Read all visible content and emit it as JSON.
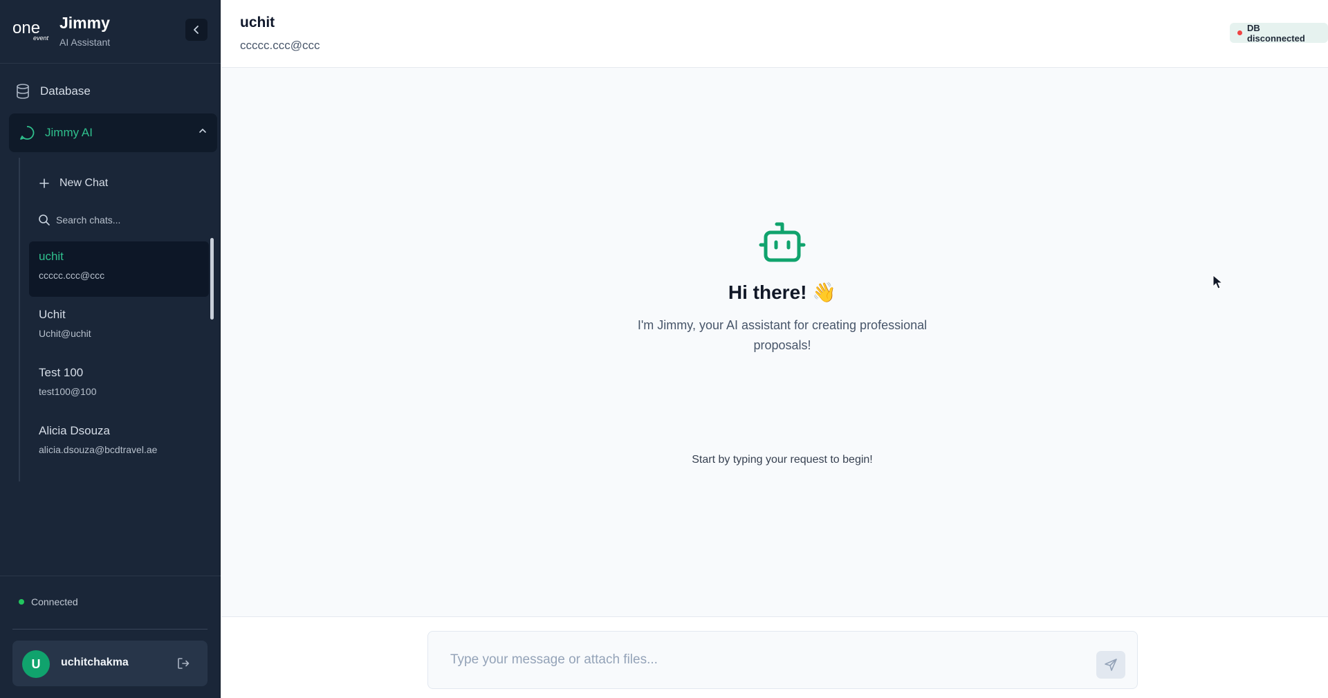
{
  "brand": {
    "logo_text": "one",
    "logo_subtext": "event",
    "name": "Jimmy",
    "subtitle": "AI Assistant"
  },
  "nav": {
    "database": "Database",
    "jimmy_ai": "Jimmy AI"
  },
  "chats": {
    "new_chat": "New Chat",
    "search_placeholder": "Search chats...",
    "items": [
      {
        "name": "uchit",
        "email": "ccccc.ccc@ccc"
      },
      {
        "name": "Uchit",
        "email": "Uchit@uchit"
      },
      {
        "name": "Test 100",
        "email": "test100@100"
      },
      {
        "name": "Alicia Dsouza",
        "email": "alicia.dsouza@bcdtravel.ae"
      }
    ]
  },
  "status": {
    "connected": "Connected"
  },
  "user": {
    "initial": "U",
    "name": "uchitchakma"
  },
  "header": {
    "title": "uchit",
    "subtitle": "ccccc.ccc@ccc",
    "db_status": "DB disconnected"
  },
  "welcome": {
    "greeting": "Hi there! 👋",
    "intro": "I'm Jimmy, your AI assistant for creating professional proposals!",
    "hint": "Start by typing your request to begin!"
  },
  "composer": {
    "placeholder": "Type your message or attach files..."
  },
  "colors": {
    "accent": "#2fc08d",
    "sidebar_bg": "#1a2638",
    "connected": "#22c55e",
    "disconnected": "#ef4444"
  }
}
